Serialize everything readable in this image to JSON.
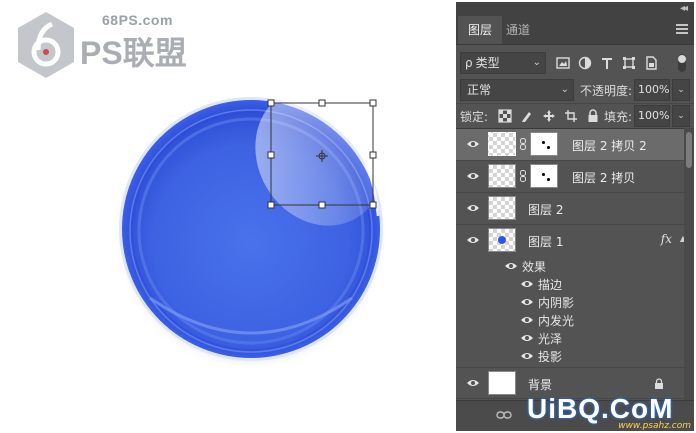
{
  "canvas": {
    "logo": {
      "url": "68PS.com",
      "text": "PS联盟"
    },
    "selection_handles": true
  },
  "panel": {
    "collapse_label": "◂◂",
    "close_label": "✕",
    "tabs": [
      {
        "label": "图层",
        "active": true
      },
      {
        "label": "通道",
        "active": false
      }
    ],
    "filter": {
      "kind": "类型",
      "search_glyph": "ρ"
    },
    "blend_mode": "正常",
    "opacity_label": "不透明度:",
    "opacity_value": "100%",
    "lock_label": "锁定:",
    "fill_label": "填充:",
    "fill_value": "100%",
    "layers": [
      {
        "name": "图层 2 拷贝 2",
        "selected": true,
        "has_mask": true
      },
      {
        "name": "图层 2 拷贝",
        "selected": false,
        "has_mask": true
      },
      {
        "name": "图层 2",
        "selected": false,
        "has_mask": false
      },
      {
        "name": "图层 1",
        "selected": false,
        "has_mask": false,
        "fx": "fx"
      },
      {
        "name": "背景",
        "selected": false,
        "locked": true
      }
    ],
    "effects_header": "效果",
    "effects": [
      "描边",
      "内阴影",
      "内发光",
      "光泽",
      "投影"
    ]
  },
  "watermark": {
    "text": "UiBQ.CoM",
    "url": "www.psahz.com"
  },
  "colors": {
    "panel_bg": "#535353",
    "selected_layer": "#6b6b6b",
    "orb_blue": "#3a5de0"
  }
}
